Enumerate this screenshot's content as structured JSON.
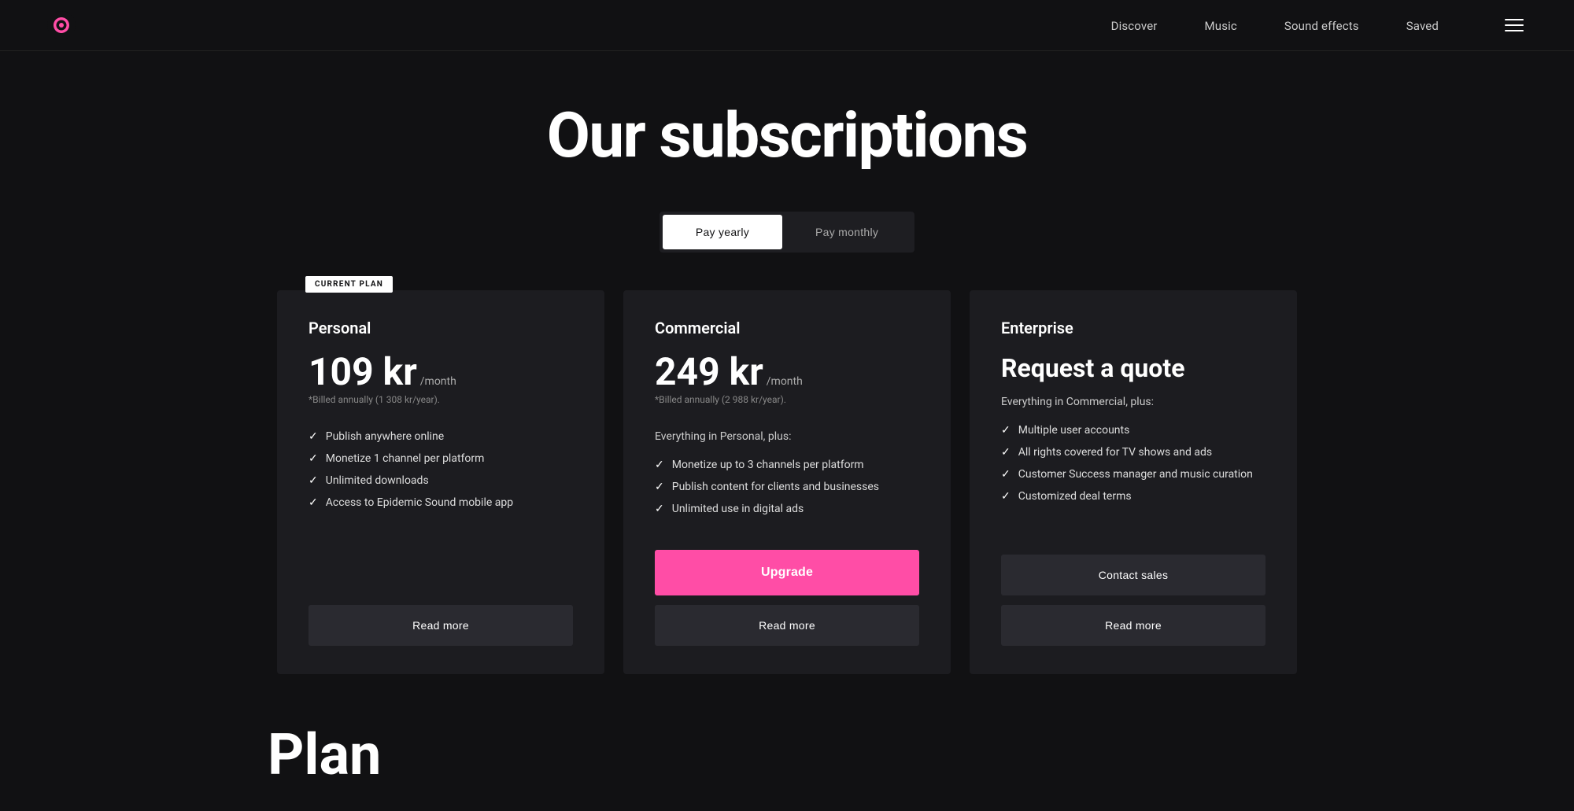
{
  "nav": {
    "logo_alt": "Epidemic Sound",
    "links": [
      {
        "label": "Discover",
        "id": "discover"
      },
      {
        "label": "Music",
        "id": "music"
      },
      {
        "label": "Sound effects",
        "id": "sound-effects"
      },
      {
        "label": "Saved",
        "id": "saved"
      }
    ]
  },
  "hero": {
    "title": "Our subscriptions"
  },
  "toggle": {
    "yearly_label": "Pay yearly",
    "monthly_label": "Pay monthly",
    "active": "yearly"
  },
  "plans": [
    {
      "id": "personal",
      "name": "Personal",
      "is_current": true,
      "current_badge": "CURRENT PLAN",
      "price_amount": "109 kr",
      "price_period": "/month",
      "price_note": "*Billed annually (1 308 kr/year).",
      "description": null,
      "features_intro": null,
      "features": [
        "Publish anywhere online",
        "Monetize 1 channel per platform",
        "Unlimited downloads",
        "Access to Epidemic Sound mobile app"
      ],
      "quote": null,
      "has_upgrade": false,
      "has_contact": false,
      "read_more_label": "Read more"
    },
    {
      "id": "commercial",
      "name": "Commercial",
      "is_current": false,
      "current_badge": null,
      "price_amount": "249 kr",
      "price_period": "/month",
      "price_note": "*Billed annually (2 988 kr/year).",
      "description": null,
      "features_intro": "Everything in Personal, plus:",
      "features": [
        "Monetize up to 3 channels per platform",
        "Publish content for clients and businesses",
        "Unlimited use in digital ads"
      ],
      "quote": null,
      "has_upgrade": true,
      "upgrade_label": "Upgrade",
      "has_contact": false,
      "read_more_label": "Read more"
    },
    {
      "id": "enterprise",
      "name": "Enterprise",
      "is_current": false,
      "current_badge": null,
      "price_amount": null,
      "price_period": null,
      "price_note": null,
      "description": null,
      "features_intro": "Everything in Commercial, plus:",
      "features": [
        "Multiple user accounts",
        "All rights covered for TV shows and ads",
        "Customer Success manager and music curation",
        "Customized deal terms"
      ],
      "quote": "Request a quote",
      "has_upgrade": false,
      "has_contact": true,
      "contact_label": "Contact sales",
      "read_more_label": "Read more"
    }
  ],
  "bottom": {
    "title": "Plan"
  }
}
